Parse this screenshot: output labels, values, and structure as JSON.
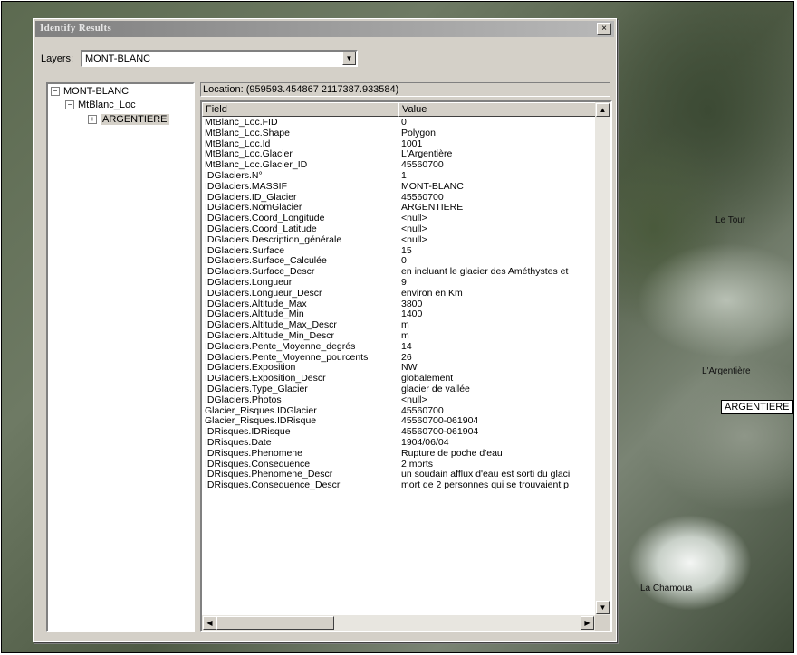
{
  "dialog": {
    "title": "Identify Results",
    "close_glyph": "×",
    "layers_label": "Layers:",
    "layers_value": "MONT-BLANC"
  },
  "tree": {
    "root": "MONT-BLANC",
    "child": "MtBlanc_Loc",
    "leaf": "ARGENTIERE",
    "minus": "−",
    "plus": "+"
  },
  "location": "Location: (959593.454867 2117387.933584)",
  "grid": {
    "headers": {
      "field": "Field",
      "value": "Value"
    },
    "rows": [
      {
        "field": "MtBlanc_Loc.FID",
        "value": "0"
      },
      {
        "field": "MtBlanc_Loc.Shape",
        "value": "Polygon"
      },
      {
        "field": "MtBlanc_Loc.Id",
        "value": "1001"
      },
      {
        "field": "MtBlanc_Loc.Glacier",
        "value": "L'Argentière"
      },
      {
        "field": "MtBlanc_Loc.Glacier_ID",
        "value": "45560700"
      },
      {
        "field": "IDGlaciers.N°",
        "value": "1"
      },
      {
        "field": "IDGlaciers.MASSIF",
        "value": "MONT-BLANC"
      },
      {
        "field": "IDGlaciers.ID_Glacier",
        "value": "45560700"
      },
      {
        "field": "IDGlaciers.NomGlacier",
        "value": "ARGENTIERE"
      },
      {
        "field": "IDGlaciers.Coord_Longitude",
        "value": "<null>"
      },
      {
        "field": "IDGlaciers.Coord_Latitude",
        "value": "<null>"
      },
      {
        "field": "IDGlaciers.Description_générale",
        "value": "<null>"
      },
      {
        "field": "IDGlaciers.Surface",
        "value": "15"
      },
      {
        "field": "IDGlaciers.Surface_Calculée",
        "value": "0"
      },
      {
        "field": "IDGlaciers.Surface_Descr",
        "value": "en incluant le glacier des Améthystes et"
      },
      {
        "field": "IDGlaciers.Longueur",
        "value": "9"
      },
      {
        "field": "IDGlaciers.Longueur_Descr",
        "value": "environ en Km"
      },
      {
        "field": "IDGlaciers.Altitude_Max",
        "value": "3800"
      },
      {
        "field": "IDGlaciers.Altitude_Min",
        "value": "1400"
      },
      {
        "field": "IDGlaciers.Altitude_Max_Descr",
        "value": "m"
      },
      {
        "field": "IDGlaciers.Altitude_Min_Descr",
        "value": "m"
      },
      {
        "field": "IDGlaciers.Pente_Moyenne_degrés",
        "value": "14"
      },
      {
        "field": "IDGlaciers.Pente_Moyenne_pourcents",
        "value": "26"
      },
      {
        "field": "IDGlaciers.Exposition",
        "value": "NW"
      },
      {
        "field": "IDGlaciers.Exposition_Descr",
        "value": "globalement"
      },
      {
        "field": "IDGlaciers.Type_Glacier",
        "value": "glacier de vallée"
      },
      {
        "field": "IDGlaciers.Photos",
        "value": "<null>"
      },
      {
        "field": "Glacier_Risques.IDGlacier",
        "value": "45560700"
      },
      {
        "field": "Glacier_Risques.IDRisque",
        "value": "45560700-061904"
      },
      {
        "field": "IDRisques.IDRisque",
        "value": "45560700-061904"
      },
      {
        "field": "IDRisques.Date",
        "value": "1904/06/04"
      },
      {
        "field": "IDRisques.Phenomene",
        "value": "Rupture de poche d'eau"
      },
      {
        "field": "IDRisques.Consequence",
        "value": "2 morts"
      },
      {
        "field": "IDRisques.Phenomene_Descr",
        "value": "un soudain afflux d'eau est sorti du glaci"
      },
      {
        "field": "IDRisques.Consequence_Descr",
        "value": "mort de 2 personnes qui se trouvaient p"
      }
    ]
  },
  "map": {
    "labels": {
      "le_tour": "Le Tour",
      "argentiere_town": "L'Argentière",
      "argentiere_tag": "ARGENTIERE",
      "chamonix": "La Chamoua"
    }
  },
  "icons": {
    "arrow_up": "▲",
    "arrow_down": "▼",
    "arrow_left": "◀",
    "arrow_right": "▶"
  }
}
